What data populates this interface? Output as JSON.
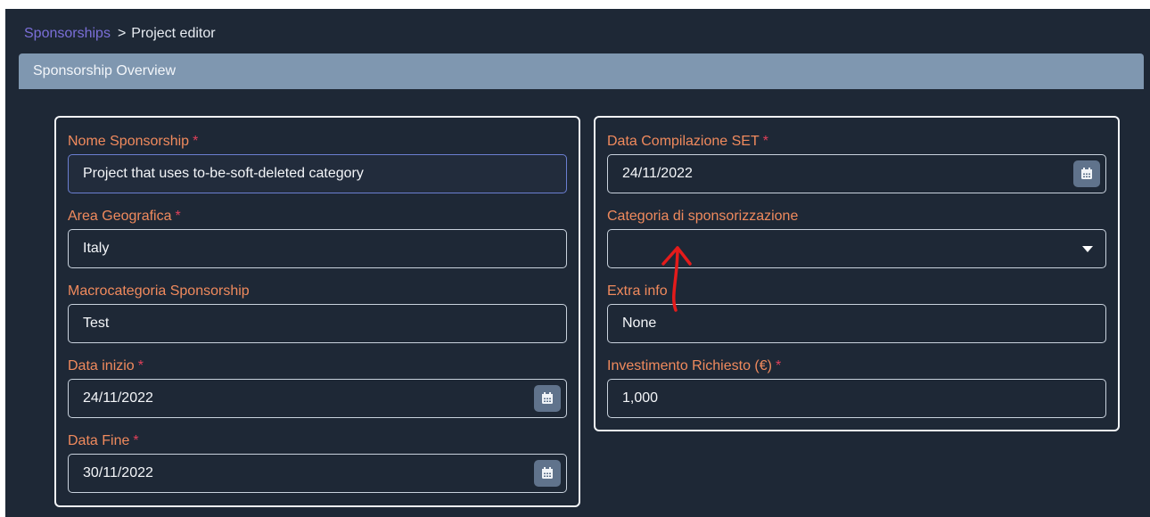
{
  "breadcrumb": {
    "link": "Sponsorships",
    "separator": ">",
    "current": "Project editor"
  },
  "panel": {
    "title": "Sponsorship Overview"
  },
  "left_card": {
    "nome": {
      "label": "Nome Sponsorship",
      "required": "*",
      "value": "Project that uses to-be-soft-deleted category"
    },
    "area": {
      "label": "Area Geografica",
      "required": "*",
      "value": "Italy"
    },
    "macro": {
      "label": "Macrocategoria Sponsorship",
      "value": "Test"
    },
    "inizio": {
      "label": "Data inizio",
      "required": "*",
      "value": "24/11/2022"
    },
    "fine": {
      "label": "Data Fine",
      "required": "*",
      "value": "30/11/2022"
    }
  },
  "right_card": {
    "compilazione": {
      "label": "Data Compilazione SET",
      "required": "*",
      "value": "24/11/2022"
    },
    "categoria": {
      "label": "Categoria di sponsorizzazione",
      "value": ""
    },
    "extra": {
      "label": "Extra info",
      "value": "None"
    },
    "investimento": {
      "label": "Investimento Richiesto (€)",
      "required": "*",
      "value": "1,000"
    }
  },
  "colors": {
    "background": "#1e2836",
    "header": "#7f97b0",
    "label": "#f08a5d",
    "required": "#e0405a",
    "link": "#7b6fd9",
    "annotation": "#e41b1b"
  },
  "icons": {
    "date": "calendar-icon",
    "dropdown": "caret-down-icon",
    "annotation": "red-arrow-annotation"
  }
}
